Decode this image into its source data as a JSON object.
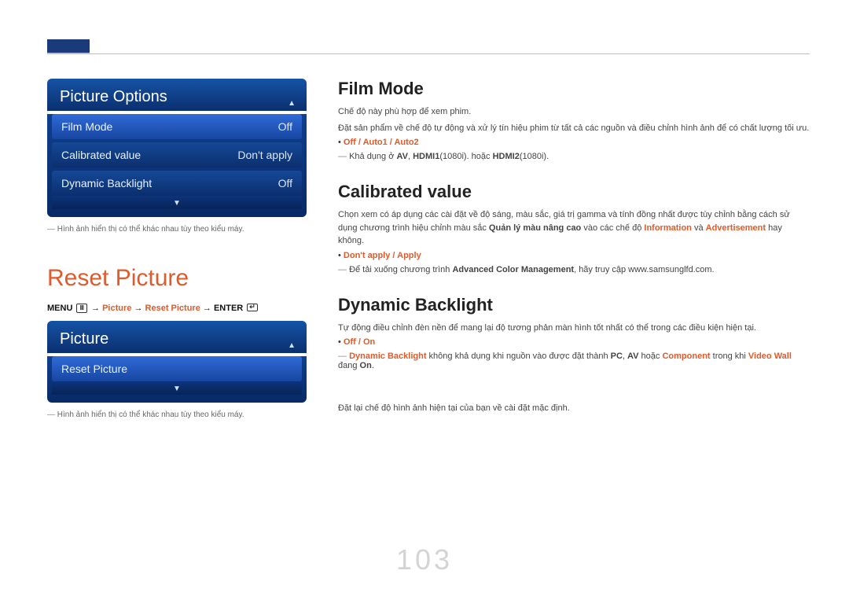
{
  "page_number": "103",
  "osd1": {
    "title": "Picture Options",
    "rows": [
      {
        "label": "Film Mode",
        "value": "Off",
        "selected": true
      },
      {
        "label": "Calibrated value",
        "value": "Don't apply",
        "selected": false
      },
      {
        "label": "Dynamic Backlight",
        "value": "Off",
        "selected": false
      }
    ]
  },
  "footnote1": "Hình ảnh hiển thị có thể khác nhau tùy theo kiểu máy.",
  "reset_heading": "Reset Picture",
  "menu_path": {
    "menu": "MENU",
    "picture": "Picture",
    "reset": "Reset Picture",
    "enter": "ENTER"
  },
  "osd2": {
    "title": "Picture",
    "rows": [
      {
        "label": "Reset Picture",
        "value": "",
        "selected": true
      }
    ]
  },
  "footnote2": "Hình ảnh hiển thị có thể khác nhau tùy theo kiểu máy.",
  "film_mode": {
    "heading": "Film Mode",
    "p1": "Chế độ này phù hợp để xem phim.",
    "p2": "Đặt sản phẩm về chế độ tự động và xử lý tín hiệu phim từ tất cả các nguồn và điều chỉnh hình ảnh để có chất lượng tối ưu.",
    "options": "Off / Auto1 / Auto2",
    "note_pre": "Khả dụng ở ",
    "note_av": "AV",
    "note_mid1": ", ",
    "note_h1": "HDMI1",
    "note_h1s": "(1080i). hoặc ",
    "note_h2": "HDMI2",
    "note_h2s": "(1080i)."
  },
  "calibrated": {
    "heading": "Calibrated value",
    "p1a": "Chọn xem có áp dụng các cài đặt về độ sáng, màu sắc, giá trị gamma và tính đồng nhất được tùy chỉnh bằng cách sử dụng chương trình hiệu chỉnh màu sắc ",
    "p1_strong": "Quản lý màu nâng cao",
    "p1b": " vào các chế độ ",
    "p1_info": "Information",
    "p1c": " và ",
    "p1_adv": "Advertisement",
    "p1d": " hay không.",
    "options": "Don't apply / Apply",
    "note_pre": "Để tải xuống chương trình ",
    "note_acm": "Advanced Color Management",
    "note_post": ", hãy truy cập www.samsunglfd.com."
  },
  "dynamic": {
    "heading": "Dynamic Backlight",
    "p1": "Tự động điều chỉnh đèn nền để mang lại độ tương phản màn hình tốt nhất có thể trong các điều kiện hiện tại.",
    "options": "Off / On",
    "note_db": "Dynamic Backlight",
    "note_a": " không khả dụng khi nguồn vào được đặt thành ",
    "note_pc": "PC",
    "note_b": ", ",
    "note_av": "AV",
    "note_c": " hoặc ",
    "note_comp": "Component",
    "note_d": " trong khi ",
    "note_vw": "Video Wall",
    "note_e": " đang ",
    "note_on": "On",
    "note_f": "."
  },
  "reset_text": "Đặt lại chế độ hình ảnh hiện tại của bạn về cài đặt mặc định."
}
